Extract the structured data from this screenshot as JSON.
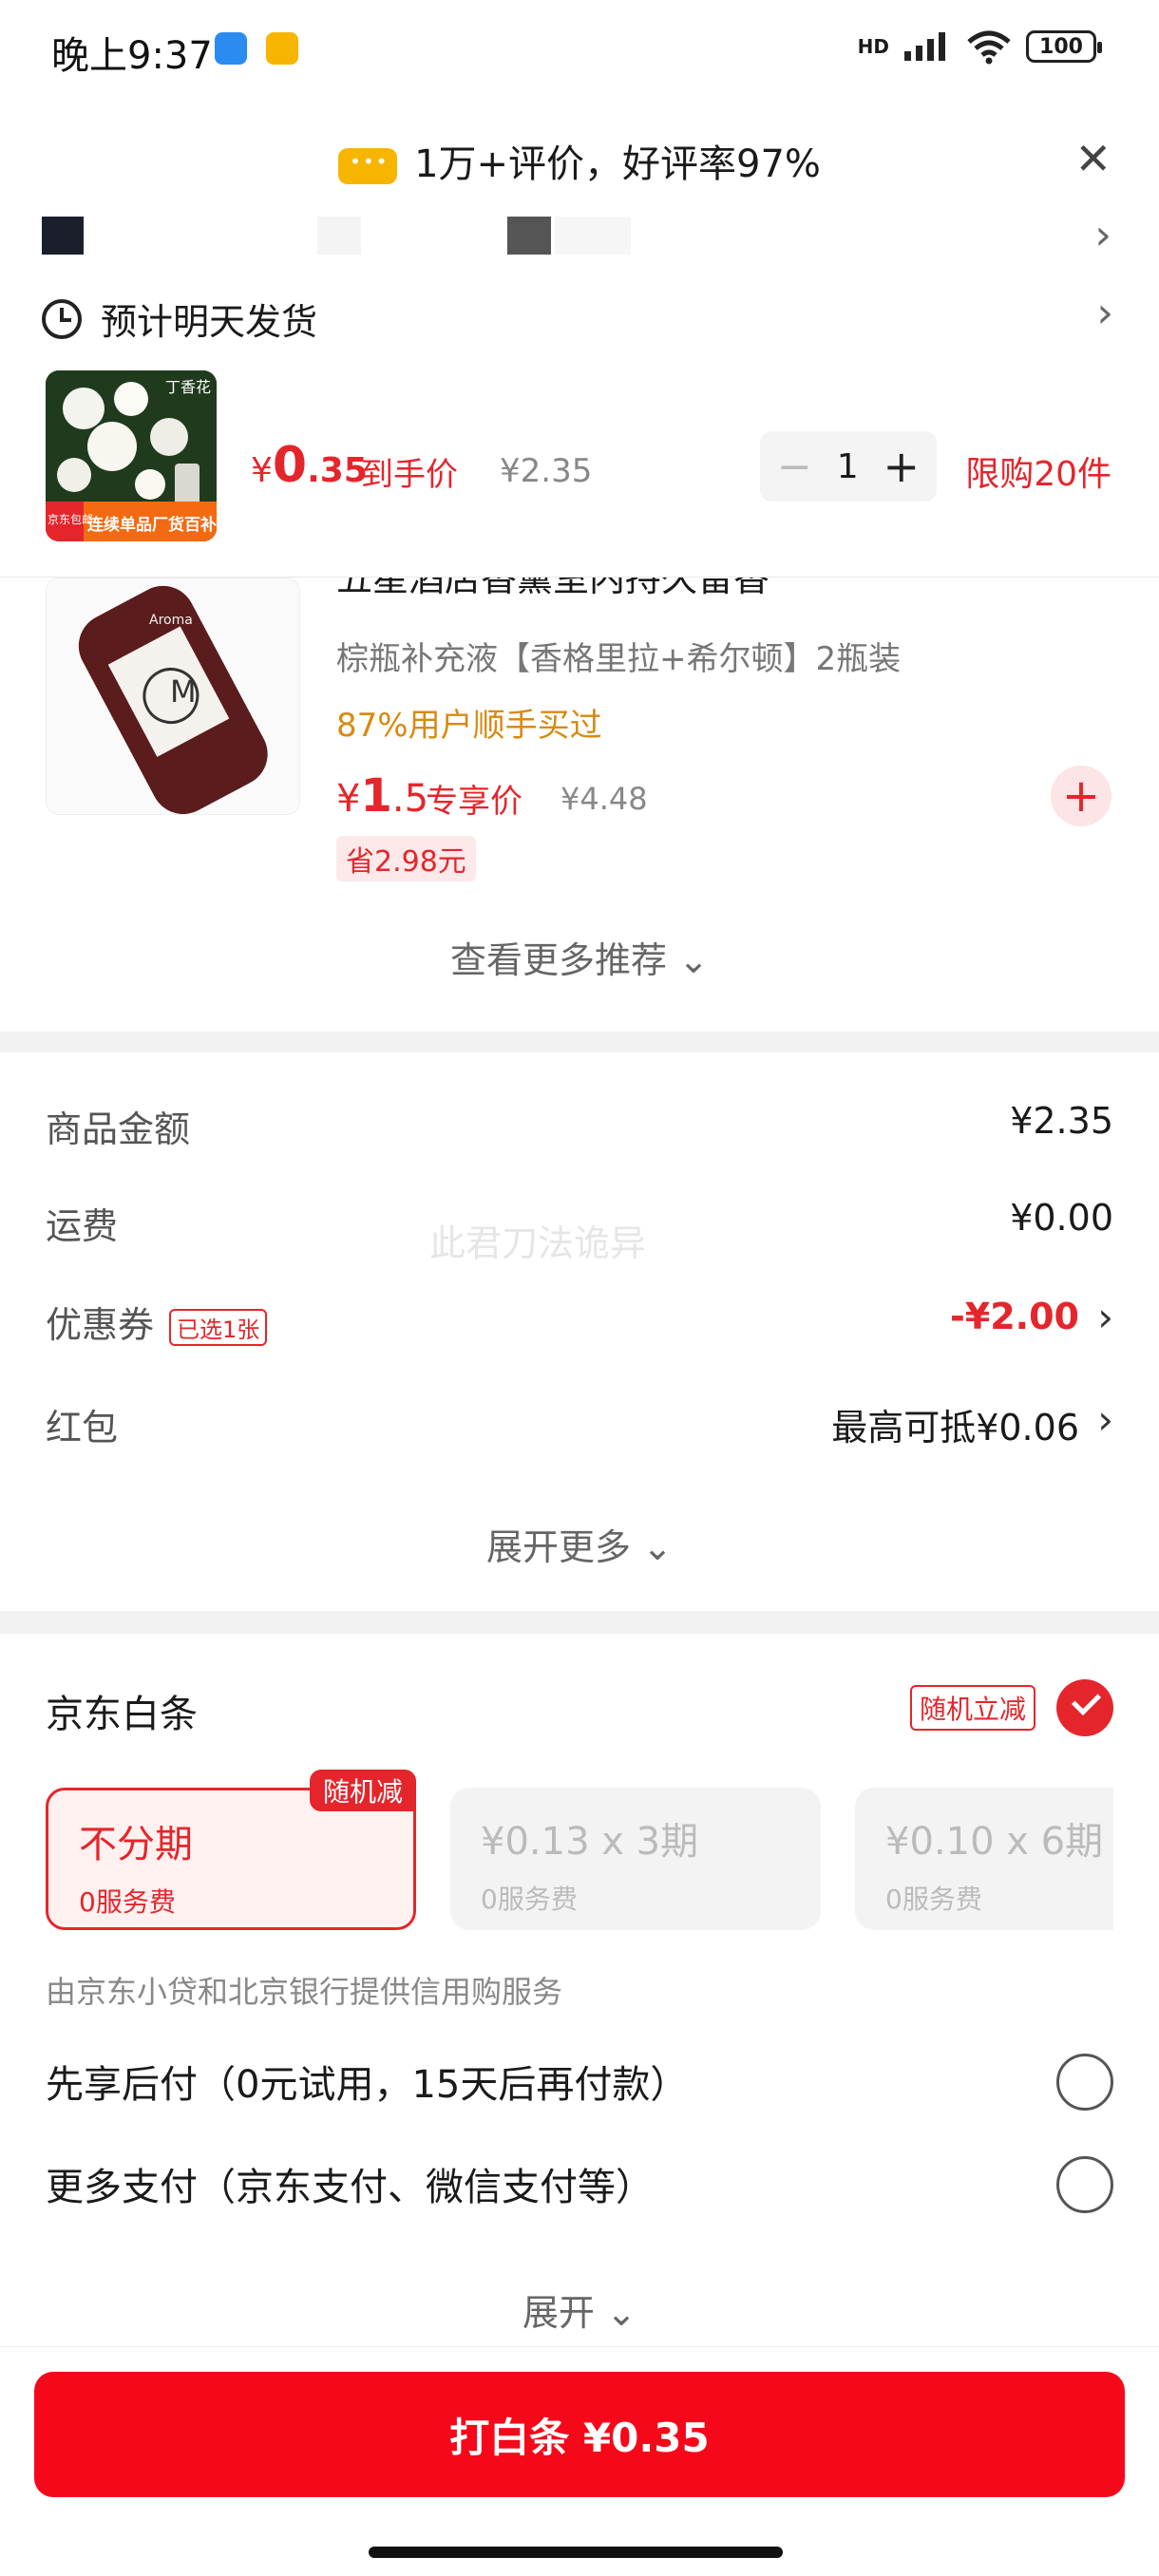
{
  "status": {
    "time": "晚上9:37",
    "signal": "HD",
    "wifi_tag": "6",
    "battery": "100",
    "colors": {
      "app1": "#2a8cf0",
      "app2": "#f7b500"
    }
  },
  "header": {
    "reviews": "1万+评价，好评率97%",
    "delivery": "预计明天发货"
  },
  "product": {
    "thumb_tag_left": "京东包邮",
    "thumb_tag_right": "丁香花",
    "thumb_banner": "连续单品厂货百补",
    "price_symbol": "¥",
    "price_int": "0",
    "price_dec": ".35",
    "price_label": "到手价",
    "orig_price": "¥2.35",
    "qty": "1",
    "limit": "限购20件"
  },
  "recommendation": {
    "title": "五星酒店香薰室内持久留香",
    "subtitle": "棕瓶补充液【香格里拉+希尔顿】2瓶装",
    "buyers": "87%用户顺手买过",
    "price_symbol": "¥",
    "price_int": "1",
    "price_dec": ".5",
    "price_label": "专享价",
    "orig_price": "¥4.48",
    "save": "省2.98元",
    "bottle_brand": "Aroma",
    "bottle_letter": "M",
    "more": "查看更多推荐"
  },
  "amounts": {
    "rows": [
      {
        "label": "商品金额",
        "value": "¥2.35"
      },
      {
        "label": "运费",
        "value": "¥0.00"
      },
      {
        "label": "优惠券",
        "tag": "已选1张",
        "value": "-¥2.00"
      },
      {
        "label": "红包",
        "value": "最高可抵¥0.06"
      }
    ],
    "watermark": "此君刀法诡异",
    "expand": "展开更多"
  },
  "payment": {
    "baitiao_title": "京东白条",
    "random_tag": "随机立减",
    "plans": [
      {
        "title": "不分期",
        "fee": "0服务费",
        "corner": "随机减"
      },
      {
        "title": "¥0.13 x 3期",
        "fee": "0服务费"
      },
      {
        "title": "¥0.10 x 6期",
        "fee": "0服务费"
      }
    ],
    "provider": "由京东小贷和北京银行提供信用购服务",
    "options": [
      "先享后付（0元试用，15天后再付款）",
      "更多支付（京东支付、微信支付等）"
    ],
    "expand": "展开"
  },
  "footer": {
    "submit": "打白条 ¥0.35"
  }
}
